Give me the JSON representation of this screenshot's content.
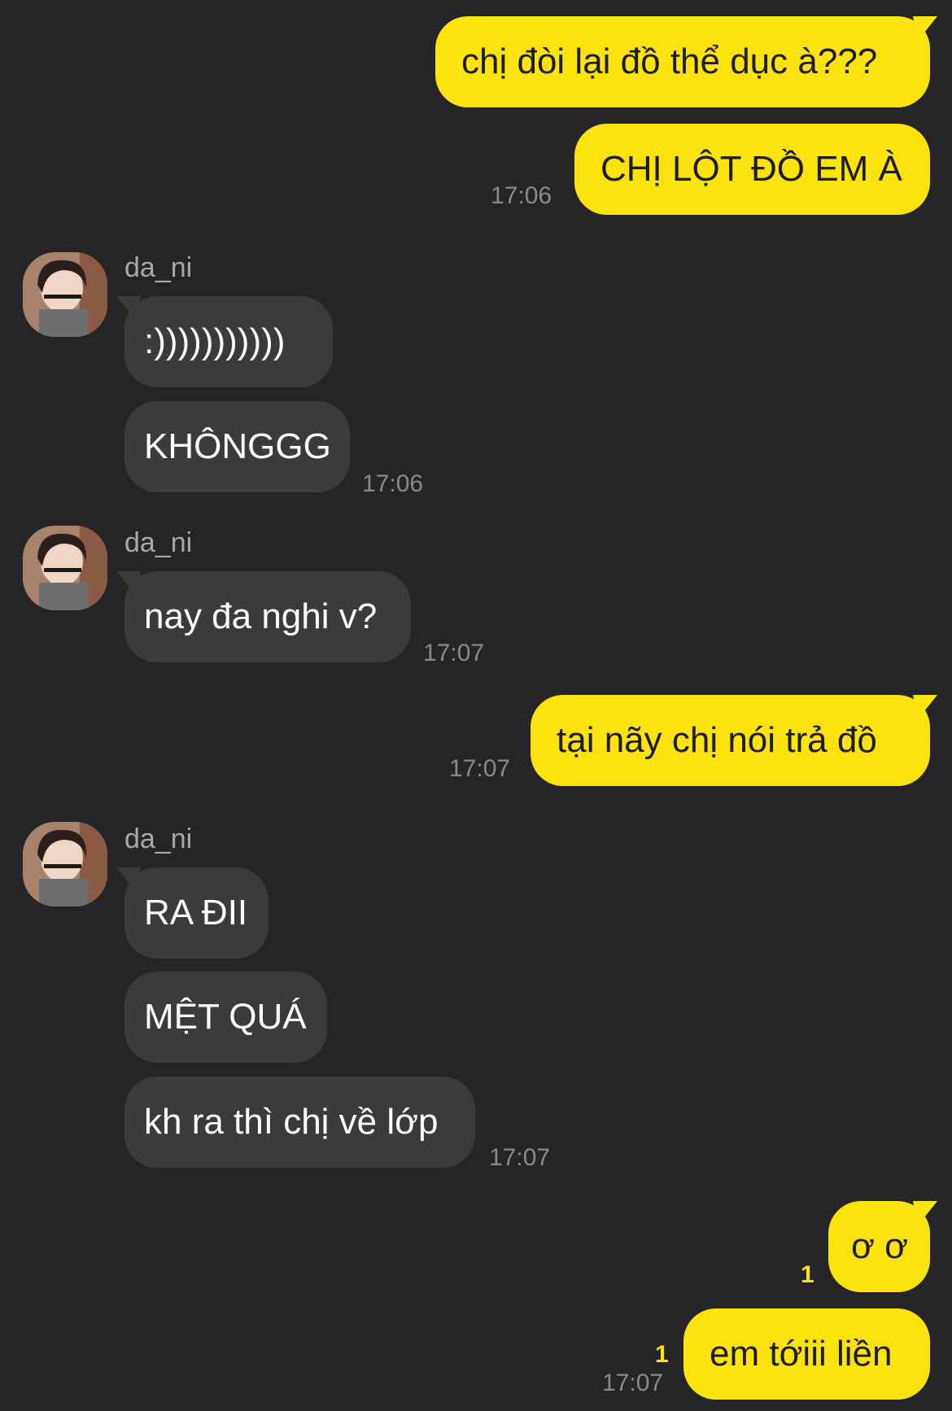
{
  "colors": {
    "background": "#252527",
    "outgoing": "#fce30d",
    "incoming": "#3b3b3d",
    "unread": "#fce30d"
  },
  "contact": {
    "name": "da_ni",
    "avatar": "avatar-photo"
  },
  "messages": [
    {
      "dir": "out",
      "text": "chị đòi lại đồ thể dục à???"
    },
    {
      "dir": "out",
      "text": "CHỊ LỘT ĐỒ EM À",
      "time": "17:06"
    },
    {
      "dir": "in",
      "sender": "da_ni",
      "text": ":)))))))))))"
    },
    {
      "dir": "in",
      "text": "KHÔNGGG",
      "time": "17:06"
    },
    {
      "dir": "in",
      "sender": "da_ni",
      "text": "nay đa nghi v?",
      "time": "17:07"
    },
    {
      "dir": "out",
      "text": "tại nãy chị nói trả đồ",
      "time": "17:07"
    },
    {
      "dir": "in",
      "sender": "da_ni",
      "text": "RA ĐII"
    },
    {
      "dir": "in",
      "text": "MỆT QUÁ"
    },
    {
      "dir": "in",
      "text": "kh ra thì chị về lớp",
      "time": "17:07"
    },
    {
      "dir": "out",
      "text": "ơ ơ",
      "unread": "1"
    },
    {
      "dir": "out",
      "text": "em tớiii liền",
      "unread": "1",
      "time": "17:07"
    }
  ]
}
